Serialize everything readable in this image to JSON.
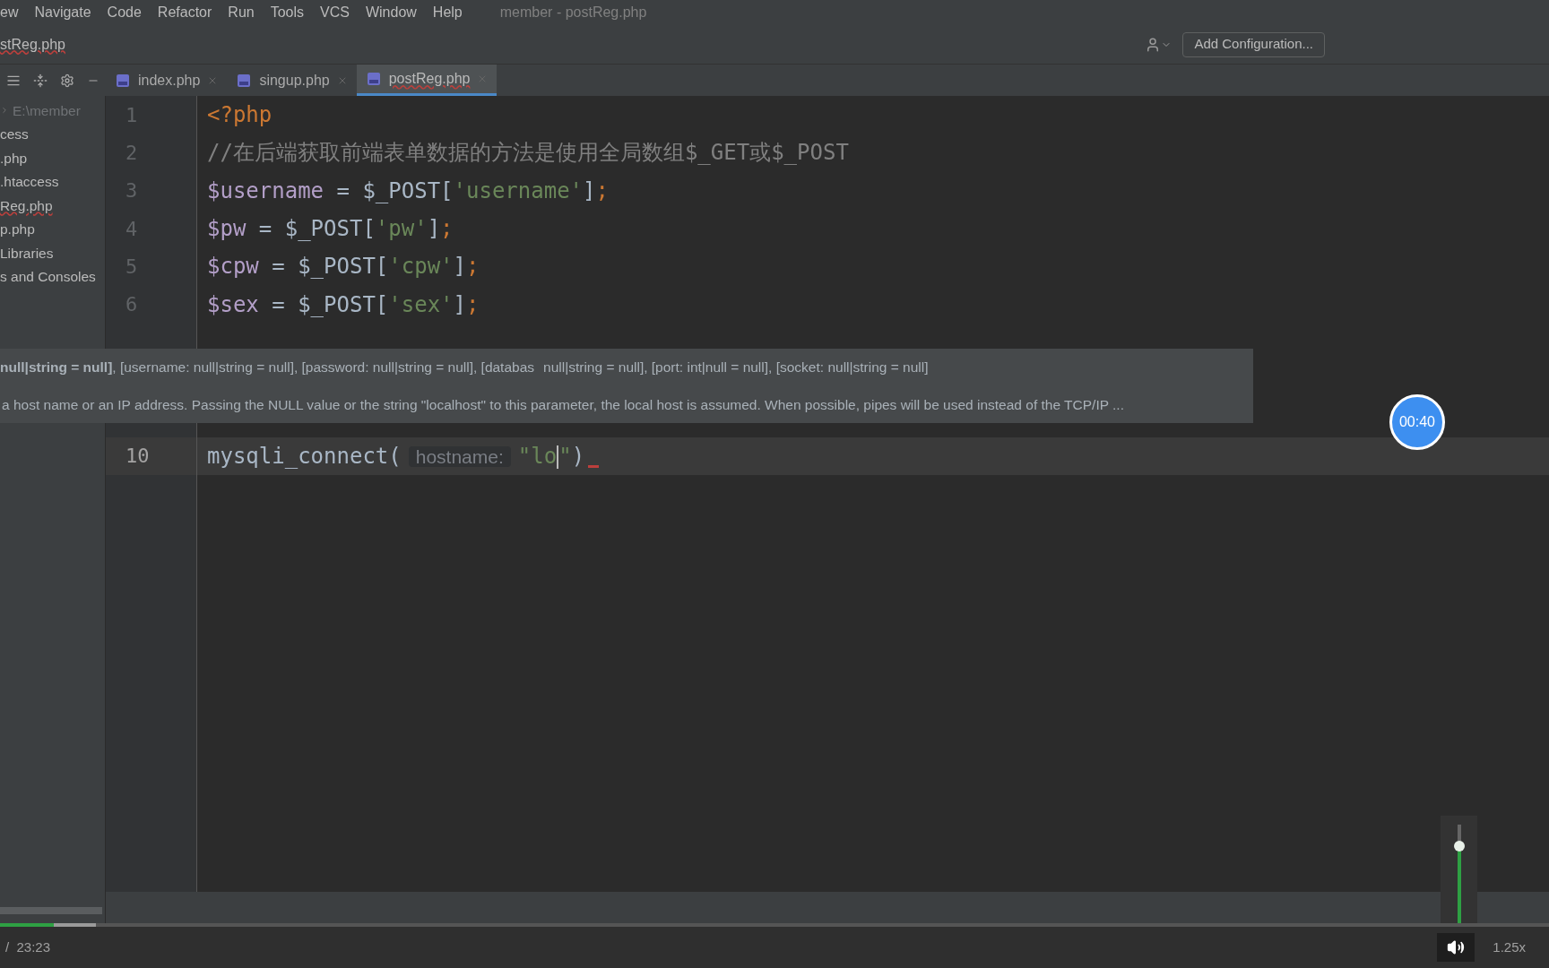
{
  "menu": {
    "items": [
      "ew",
      "Navigate",
      "Code",
      "Refactor",
      "Run",
      "Tools",
      "VCS",
      "Window",
      "Help"
    ],
    "title": "member - postReg.php"
  },
  "breadcrumb": {
    "label": "stReg.php",
    "error": true
  },
  "toolbar": {
    "config_button": "Add Configuration..."
  },
  "tabs": [
    {
      "label": "index.php",
      "selected": false,
      "error": false
    },
    {
      "label": "singup.php",
      "selected": false,
      "error": false
    },
    {
      "label": "postReg.php",
      "selected": true,
      "error": true
    }
  ],
  "project_tree": [
    {
      "kind": "root",
      "label": "E:\\member",
      "error": false
    },
    {
      "kind": "item",
      "label": "cess",
      "error": false
    },
    {
      "kind": "item",
      "label": ".php",
      "error": false
    },
    {
      "kind": "item",
      "label": ".htaccess",
      "error": false
    },
    {
      "kind": "item",
      "label": "Reg.php",
      "error": true
    },
    {
      "kind": "item",
      "label": "p.php",
      "error": false
    },
    {
      "kind": "item",
      "label": "Libraries",
      "error": false
    },
    {
      "kind": "item",
      "label": "s and Consoles",
      "error": false
    }
  ],
  "editor": {
    "lines": [
      {
        "number": "1",
        "current": false,
        "tokens": [
          {
            "kind": "keyword",
            "text": "<?php"
          }
        ]
      },
      {
        "number": "2",
        "current": false,
        "tokens": [
          {
            "kind": "comment",
            "text": "//在后端获取前端表单数据的方法是使用全局数组$_GET或$_POST"
          }
        ]
      },
      {
        "number": "3",
        "current": false,
        "tokens": [
          {
            "kind": "var",
            "text": "$username"
          },
          {
            "kind": "plain",
            "text": " = $_POST["
          },
          {
            "kind": "string",
            "text": "'username'"
          },
          {
            "kind": "plain",
            "text": "]"
          },
          {
            "kind": "keyword",
            "text": ";"
          }
        ]
      },
      {
        "number": "4",
        "current": false,
        "tokens": [
          {
            "kind": "var",
            "text": "$pw"
          },
          {
            "kind": "plain",
            "text": " = $_POST["
          },
          {
            "kind": "string",
            "text": "'pw'"
          },
          {
            "kind": "plain",
            "text": "]"
          },
          {
            "kind": "keyword",
            "text": ";"
          }
        ]
      },
      {
        "number": "5",
        "current": false,
        "tokens": [
          {
            "kind": "var",
            "text": "$cpw"
          },
          {
            "kind": "plain",
            "text": " = $_POST["
          },
          {
            "kind": "string",
            "text": "'cpw'"
          },
          {
            "kind": "plain",
            "text": "]"
          },
          {
            "kind": "keyword",
            "text": ";"
          }
        ]
      },
      {
        "number": "6",
        "current": false,
        "tokens": [
          {
            "kind": "var",
            "text": "$sex"
          },
          {
            "kind": "plain",
            "text": " = $_POST["
          },
          {
            "kind": "string",
            "text": "'sex'"
          },
          {
            "kind": "plain",
            "text": "]"
          },
          {
            "kind": "keyword",
            "text": ";"
          }
        ]
      },
      {
        "number": "10",
        "current": true,
        "error_mark": true,
        "tokens": [
          {
            "kind": "plain",
            "text": "mysqli_connect(",
            "cursor": false
          },
          {
            "kind": "hint",
            "text": "hostname:",
            "cursor": false
          },
          {
            "kind": "string",
            "text": "\"lo",
            "cursor": true
          },
          {
            "kind": "string",
            "text": "\"",
            "cursor": false
          },
          {
            "kind": "plain",
            "text": ")",
            "cursor": false
          }
        ]
      }
    ]
  },
  "tooltip": {
    "signature": "**null|string = null]**, [username: null|string = null], [password: null|string = null], [databas",
    "signature_rest": "null|string = null], [port: int|null = null], [socket: null|string = null]",
    "description": "a host name or an IP address. Passing the NULL value or the string \"localhost\" to this parameter, the local host is assumed. When possible, pipes will be used instead of the TCP/IP ..."
  },
  "timer": {
    "label": "00:40"
  },
  "player": {
    "progress": {
      "level": 0.035
    },
    "buffer": {
      "level": 0.062
    },
    "time": "/  23:23",
    "volume": {
      "level": 0.78
    },
    "speed": "1.25x"
  }
}
